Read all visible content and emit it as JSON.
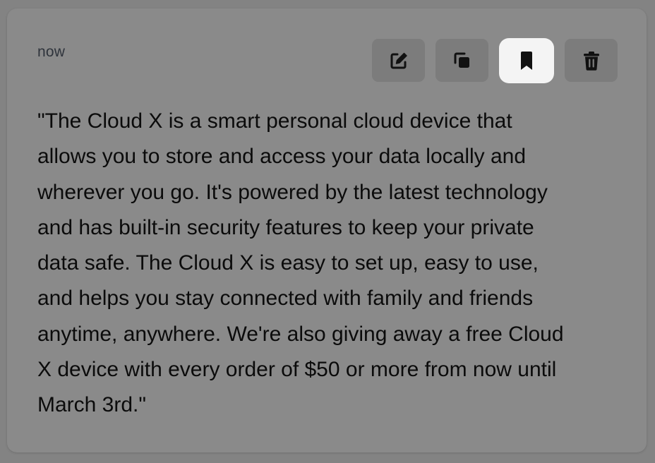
{
  "card": {
    "timestamp": "now",
    "actions": [
      {
        "name": "edit",
        "icon": "edit-icon",
        "active": false
      },
      {
        "name": "copy",
        "icon": "copy-icon",
        "active": false
      },
      {
        "name": "bookmark",
        "icon": "bookmark-icon",
        "active": true
      },
      {
        "name": "delete",
        "icon": "trash-icon",
        "active": false
      }
    ],
    "lines": [
      "\"The Cloud X is a smart personal cloud device that",
      "allows you to store and access your data locally and",
      "wherever you go. It's powered by the latest technology",
      "and has built-in security features to keep your private",
      "data safe. The Cloud X is easy to set up, easy to use,",
      "and helps you stay connected with family and friends",
      "anytime, anywhere. We're also giving away a free Cloud",
      "X device with every order of $50 or more from now until",
      "March 3rd.\""
    ]
  },
  "colors": {
    "page_background": "#838383",
    "card_background": "#8a8a8a",
    "button_background": "#7c7c7c",
    "active_button_background": "#f4f4f4",
    "text": "#0b0b0b",
    "timestamp_text": "#2f343c"
  }
}
